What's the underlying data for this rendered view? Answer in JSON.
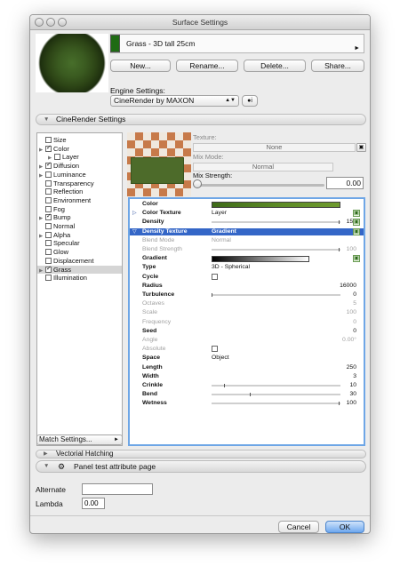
{
  "window": {
    "title": "Surface Settings"
  },
  "material": {
    "name": "Grass - 3D tall 25cm",
    "swatch_color": "#1f6b14"
  },
  "buttons": {
    "new": "New...",
    "rename": "Rename...",
    "delete": "Delete...",
    "share": "Share..."
  },
  "engine": {
    "label": "Engine Settings:",
    "value": "CineRender by MAXON"
  },
  "sections": {
    "cinerender": "CineRender Settings",
    "vectorial": "Vectorial Hatching",
    "panel": "Panel test attribute page"
  },
  "channels": [
    {
      "label": "Size",
      "checked": false,
      "has_box": false,
      "expand": false,
      "indent": 0
    },
    {
      "label": "Color",
      "checked": true,
      "has_box": true,
      "expand": true,
      "indent": 0
    },
    {
      "label": "Layer",
      "checked": false,
      "has_box": false,
      "expand": true,
      "indent": 1
    },
    {
      "label": "Diffusion",
      "checked": true,
      "has_box": true,
      "expand": true,
      "indent": 0
    },
    {
      "label": "Luminance",
      "checked": false,
      "has_box": true,
      "expand": true,
      "indent": 0
    },
    {
      "label": "Transparency",
      "checked": false,
      "has_box": true,
      "expand": false,
      "indent": 0
    },
    {
      "label": "Reflection",
      "checked": false,
      "has_box": true,
      "expand": false,
      "indent": 0
    },
    {
      "label": "Environment",
      "checked": false,
      "has_box": true,
      "expand": false,
      "indent": 0
    },
    {
      "label": "Fog",
      "checked": false,
      "has_box": true,
      "expand": false,
      "indent": 0
    },
    {
      "label": "Bump",
      "checked": true,
      "has_box": true,
      "expand": true,
      "indent": 0
    },
    {
      "label": "Normal",
      "checked": false,
      "has_box": true,
      "expand": false,
      "indent": 0
    },
    {
      "label": "Alpha",
      "checked": false,
      "has_box": true,
      "expand": true,
      "indent": 0
    },
    {
      "label": "Specular",
      "checked": false,
      "has_box": true,
      "expand": false,
      "indent": 0
    },
    {
      "label": "Glow",
      "checked": false,
      "has_box": true,
      "expand": false,
      "indent": 0
    },
    {
      "label": "Displacement",
      "checked": false,
      "has_box": true,
      "expand": false,
      "indent": 0
    },
    {
      "label": "Grass",
      "checked": true,
      "has_box": true,
      "expand": true,
      "indent": 0,
      "selected": true
    },
    {
      "label": "Illumination",
      "checked": false,
      "has_box": false,
      "expand": false,
      "indent": 0
    }
  ],
  "match_settings": "Match Settings...",
  "texture": {
    "label": "Texture:",
    "value": "None",
    "mix_mode_label": "Mix Mode:",
    "mix_mode_value": "Normal",
    "mix_strength_label": "Mix Strength:",
    "mix_strength_value": "0.00"
  },
  "params": [
    {
      "name": "Color",
      "kind": "color"
    },
    {
      "name": "Color Texture",
      "value": "Layer",
      "tri": "right",
      "btn": true
    },
    {
      "name": "Density",
      "kind": "slider",
      "pos": 1.0,
      "right": "150",
      "btn": true
    },
    {
      "name": "Density Texture",
      "value": "Gradient",
      "tri": "down",
      "hl": true,
      "btn": true
    },
    {
      "name": "Blend Mode",
      "value": "Normal",
      "dis": true
    },
    {
      "name": "Blend Strength",
      "kind": "slider",
      "pos": 1.0,
      "right": "100",
      "dis": true
    },
    {
      "name": "Gradient",
      "kind": "gradient",
      "btn": true
    },
    {
      "name": "Type",
      "value": "3D - Spherical"
    },
    {
      "name": "Cycle",
      "kind": "check"
    },
    {
      "name": "Radius",
      "right": "16000"
    },
    {
      "name": "Turbulence",
      "kind": "slider",
      "pos": 0.0,
      "right": "0"
    },
    {
      "name": "Octaves",
      "right": "5",
      "dis": true
    },
    {
      "name": "Scale",
      "right": "100",
      "dis": true
    },
    {
      "name": "Frequency",
      "right": "0",
      "dis": true
    },
    {
      "name": "Seed",
      "right": "0"
    },
    {
      "name": "Angle",
      "right": "0.00°",
      "dis": true
    },
    {
      "name": "Absolute",
      "kind": "check",
      "dis": true
    },
    {
      "name": "Space",
      "value": "Object"
    },
    {
      "name": "Length",
      "right": "250"
    },
    {
      "name": "Width",
      "right": "3"
    },
    {
      "name": "Crinkle",
      "kind": "slider",
      "pos": 0.1,
      "right": "10"
    },
    {
      "name": "Bend",
      "kind": "slider",
      "pos": 0.3,
      "right": "30"
    },
    {
      "name": "Wetness",
      "kind": "slider",
      "pos": 1.0,
      "right": "100"
    }
  ],
  "panel_fields": {
    "alternate_label": "Alternate",
    "alternate_value": "",
    "lambda_label": "Lambda",
    "lambda_value": "0.00"
  },
  "footer": {
    "cancel": "Cancel",
    "ok": "OK"
  }
}
